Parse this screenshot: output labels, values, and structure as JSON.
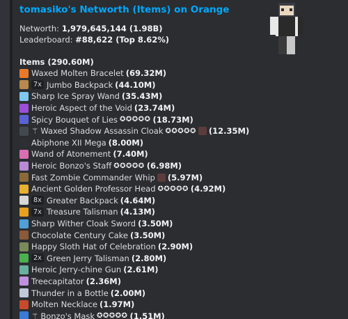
{
  "title": "tomasiko's Networth (Items) on Orange",
  "networth_label": "Networth:",
  "networth_value": "1,979,645,144 (1.98B)",
  "leaderboard_label": "Leaderboard:",
  "leaderboard_value": "#88,622 (Top 8.62%)",
  "items_header": "Items (290.60M)",
  "items": [
    {
      "name": "Waxed Molten Bracelet",
      "value": "(69.32M)",
      "icon_color": "#e8792a"
    },
    {
      "qty": "7x",
      "name": "Jumbo Backpack",
      "value": "(44.10M)",
      "icon_color": "#b8894d"
    },
    {
      "name": "Sharp Ice Spray Wand",
      "value": "(35.43M)",
      "icon_color": "#7fc8f0"
    },
    {
      "name": "Heroic Aspect of the Void",
      "value": "(23.74M)",
      "icon_color": "#9a4fd6"
    },
    {
      "name": "Spicy Bouquet of Lies",
      "stars": "✪✪✪✪✪",
      "value": "(18.73M)",
      "icon_color": "#5a62d6"
    },
    {
      "prefix": "⚚",
      "name": "Waxed Shadow Assassin Cloak",
      "stars": "✪✪✪✪✪",
      "pet": true,
      "value": "(12.35M)",
      "icon_color": "#44484f"
    },
    {
      "name": "Abiphone XII Mega",
      "value": "(8.00M)",
      "icon_color": "#2d2f34"
    },
    {
      "name": "Wand of Atonement",
      "value": "(7.40M)",
      "icon_color": "#d86fb0"
    },
    {
      "name": "Heroic Bonzo's Staff",
      "stars": "✪✪✪✪✪",
      "value": "(6.98M)",
      "icon_color": "#b78bd6"
    },
    {
      "name": "Fast Zombie Commander Whip",
      "pet": true,
      "value": "(5.97M)",
      "icon_color": "#8a6a3a"
    },
    {
      "name": "Ancient Golden Professor Head",
      "stars": "✪✪✪✪✪",
      "value": "(4.92M)",
      "icon_color": "#e8b030"
    },
    {
      "qty": "8x",
      "name": "Greater Backpack",
      "value": "(4.64M)",
      "icon_color": "#d8d8d8"
    },
    {
      "qty": "7x",
      "name": "Treasure Talisman",
      "value": "(4.13M)",
      "icon_color": "#e8a020"
    },
    {
      "name": "Sharp Wither Cloak Sword",
      "value": "(3.50M)",
      "icon_color": "#4fa0d8"
    },
    {
      "name": "Chocolate Century Cake",
      "value": "(3.50M)",
      "icon_color": "#8a5a3a"
    },
    {
      "name": "Happy Sloth Hat of Celebration",
      "value": "(2.90M)",
      "icon_color": "#7a8a5a"
    },
    {
      "qty": "2x",
      "name": "Green Jerry Talisman",
      "value": "(2.80M)",
      "icon_color": "#4caf50"
    },
    {
      "name": "Heroic Jerry-chine Gun",
      "value": "(2.61M)",
      "icon_color": "#6ab0a0"
    },
    {
      "name": "Treecapitator",
      "value": "(2.36M)",
      "icon_color": "#c090e0"
    },
    {
      "name": "Thunder in a Bottle",
      "value": "(2.00M)",
      "icon_color": "#c0c8d8"
    },
    {
      "name": "Molten Necklace",
      "value": "(1.97M)",
      "icon_color": "#c84a2a"
    },
    {
      "prefix": "⚚",
      "name": "Bonzo's Mask",
      "stars": "✪✪✪✪✪",
      "value": "(1.51M)",
      "icon_color": "#3a7ad8"
    },
    {
      "name": "",
      "value": "",
      "icon_color": "#c08040"
    }
  ]
}
